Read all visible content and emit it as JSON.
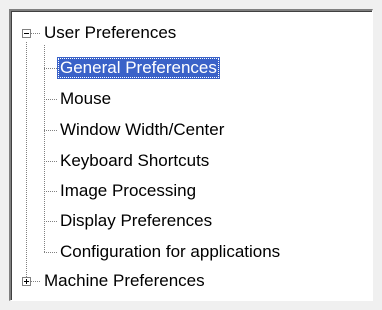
{
  "tree": {
    "root_nodes": [
      {
        "label": "User Preferences",
        "expanded": true,
        "icon": "minus-box-icon",
        "children": [
          {
            "label": "General Preferences",
            "selected": true
          },
          {
            "label": "Mouse"
          },
          {
            "label": "Window Width/Center"
          },
          {
            "label": "Keyboard Shortcuts"
          },
          {
            "label": "Image Processing"
          },
          {
            "label": "Display Preferences"
          },
          {
            "label": "Configuration for applications"
          }
        ]
      },
      {
        "label": "Machine Preferences",
        "expanded": false,
        "icon": "plus-box-icon",
        "children": []
      }
    ]
  },
  "colors": {
    "selection_background": "#3a62c8",
    "selection_text": "#ffffff",
    "connector_line": "#808080"
  }
}
